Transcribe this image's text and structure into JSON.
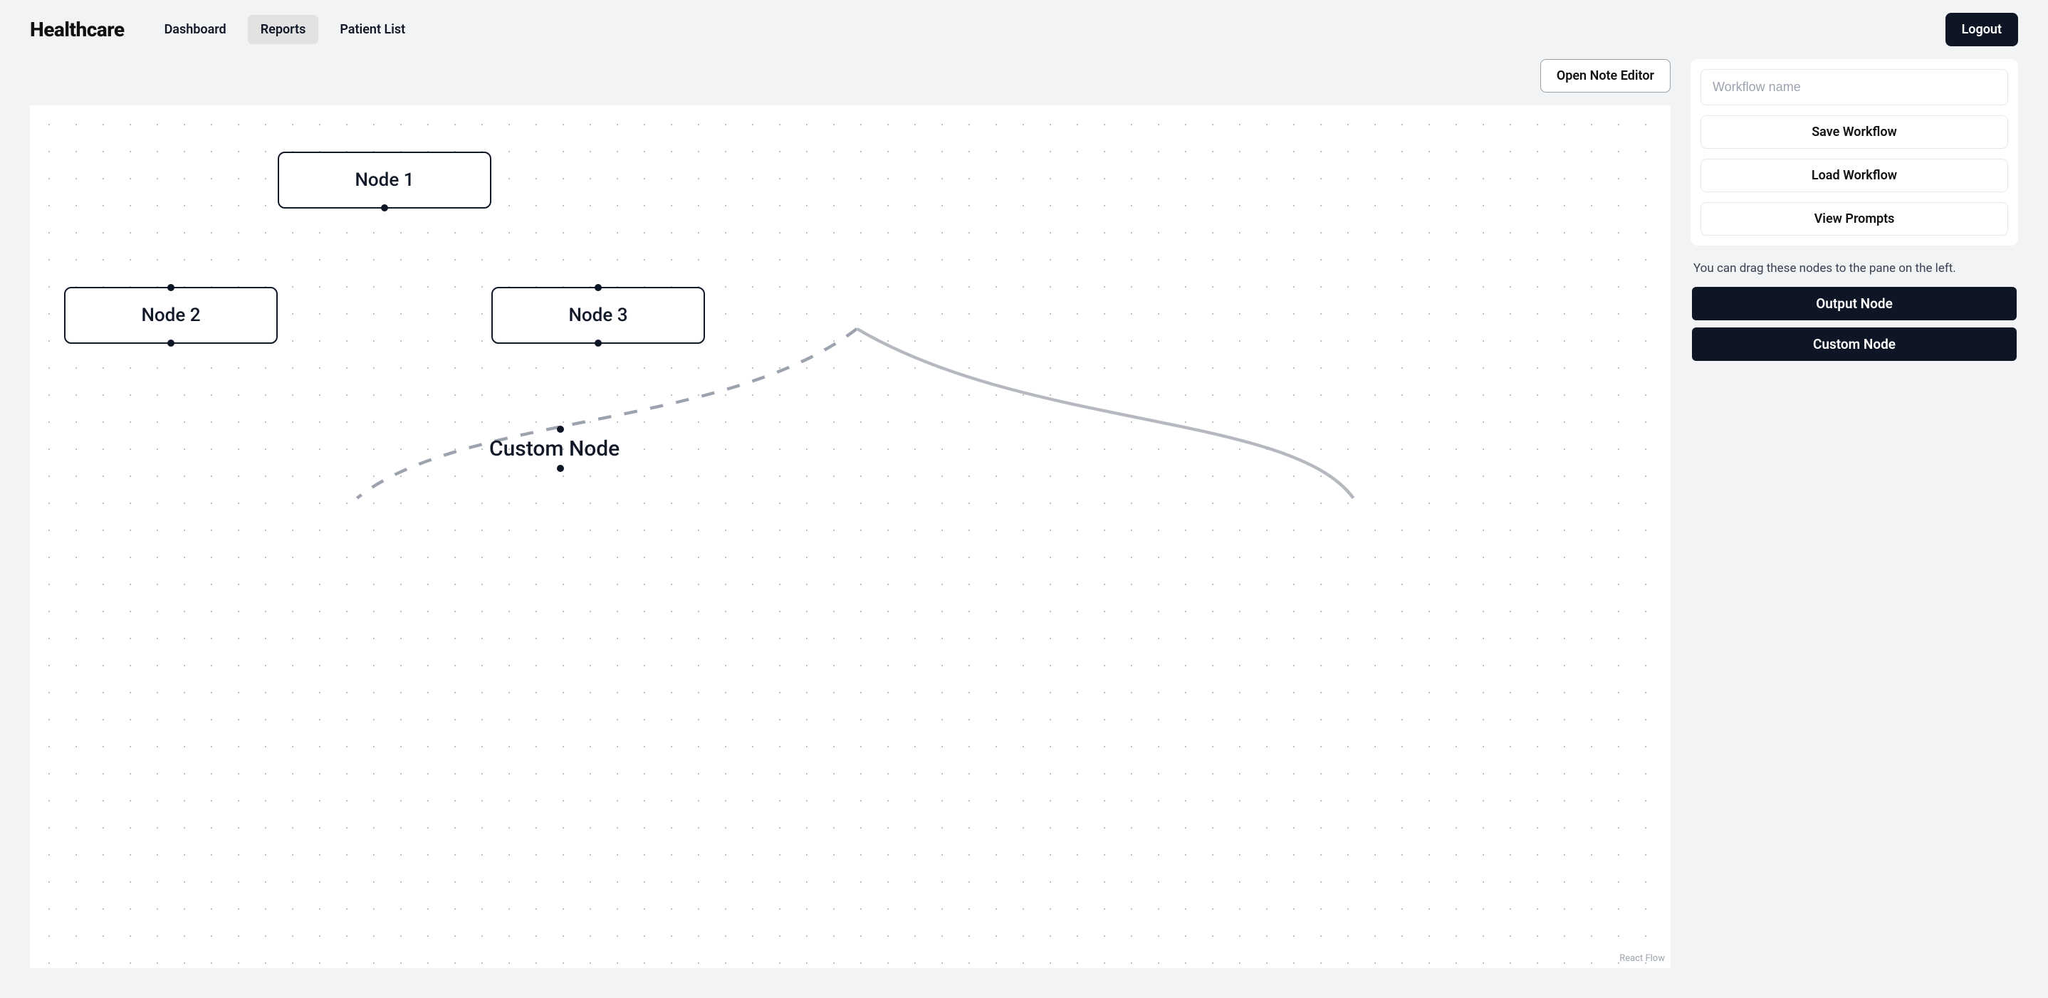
{
  "brand": "Healthcare",
  "nav": {
    "items": [
      {
        "label": "Dashboard",
        "active": false
      },
      {
        "label": "Reports",
        "active": true
      },
      {
        "label": "Patient List",
        "active": false
      }
    ],
    "logout": "Logout"
  },
  "toolbar": {
    "open_note_editor": "Open Note Editor"
  },
  "canvas": {
    "nodes": {
      "node1": {
        "label": "Node 1"
      },
      "node2": {
        "label": "Node 2"
      },
      "node3": {
        "label": "Node 3"
      },
      "custom": {
        "label": "Custom Node"
      }
    },
    "attribution": "React Flow"
  },
  "sidebar": {
    "workflow_name_placeholder": "Workflow name",
    "workflow_name_value": "",
    "save_workflow": "Save Workflow",
    "load_workflow": "Load Workflow",
    "view_prompts": "View Prompts",
    "drag_help": "You can drag these nodes to the pane on the left.",
    "draggables": {
      "output_node": "Output Node",
      "custom_node": "Custom Node"
    }
  }
}
